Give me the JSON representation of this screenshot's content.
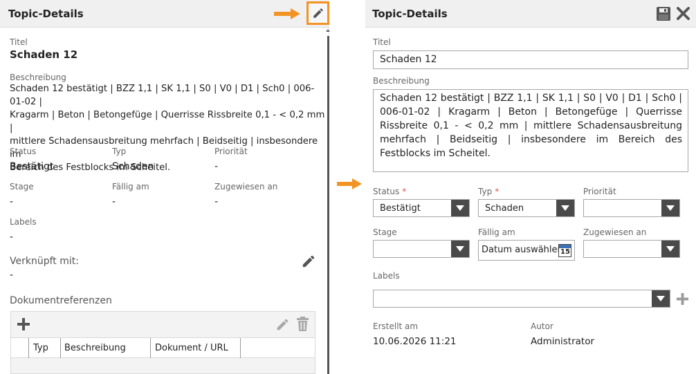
{
  "left": {
    "header": {
      "title": "Topic-Details"
    },
    "title_label": "Titel",
    "title_value": "Schaden 12",
    "desc_label": "Beschreibung",
    "desc_lines": [
      "Schaden 12 bestätigt | BZZ 1,1 | SK 1,1 | S0 | V0 | D1 | Sch0 | 006-01-02 |",
      "Kragarm | Beton | Betongefüge | Querrisse Rissbreite 0,1 - < 0,2 mm |",
      "mittlere Schadensausbreitung mehrfach | Beidseitig | insbesondere im",
      "Bereich des Festblocks im Scheitel."
    ],
    "status_label": "Status",
    "status_value": "Bestätigt",
    "typ_label": "Typ",
    "typ_value": "Schaden",
    "prio_label": "Priorität",
    "prio_value": "-",
    "stage_label": "Stage",
    "stage_value": "-",
    "faellig_label": "Fällig am",
    "faellig_value": "-",
    "zugewiesen_label": "Zugewiesen an",
    "zugewiesen_value": "-",
    "labels_label": "Labels",
    "labels_value": "-",
    "verknuepft_label": "Verknüpft mit:",
    "verknuepft_value": "-",
    "docref_label": "Dokumentreferenzen",
    "table_headers": [
      "Typ",
      "Beschreibung",
      "Dokument / URL"
    ]
  },
  "right": {
    "header": {
      "title": "Topic-Details"
    },
    "title_label": "Titel",
    "title_value": "Schaden 12",
    "desc_label": "Beschreibung",
    "desc_value": "Schaden 12 bestätigt | BZZ 1,1 | SK 1,1 | S0 | V0 | D1 | Sch0 | 006-01-02 | Kragarm | Beton | Betongefüge | Querrisse Rissbreite 0,1 - < 0,2 mm | mittlere Schadensausbreitung mehrfach | Beidseitig | insbesondere im Bereich des Festblocks im Scheitel.",
    "status_label": "Status",
    "required_mark": "*",
    "status_value": "Bestätigt",
    "typ_label": "Typ",
    "typ_value": "Schaden",
    "prio_label": "Priorität",
    "prio_value": "",
    "stage_label": "Stage",
    "stage_value": "",
    "faellig_label": "Fällig am",
    "date_placeholder": "Datum auswählen",
    "calendar_day": "15",
    "zugewiesen_label": "Zugewiesen an",
    "zugewiesen_value": "",
    "labels_label": "Labels",
    "labels_value": "",
    "erstellt_label": "Erstellt am",
    "erstellt_value": "10.06.2026 11:21",
    "autor_label": "Autor",
    "autor_value": "Administrator"
  },
  "colors": {
    "accent_orange": "#f29423",
    "header_bg": "#f0f0f0",
    "dropdown_btn": "#4a4a4a",
    "icon_grey": "#6b6b6b",
    "required_red": "#d9534f"
  },
  "icons": [
    "arrow-right-icon",
    "pencil-icon",
    "save-icon",
    "close-icon",
    "plus-icon",
    "trash-icon",
    "calendar-icon",
    "chevron-down-icon"
  ]
}
